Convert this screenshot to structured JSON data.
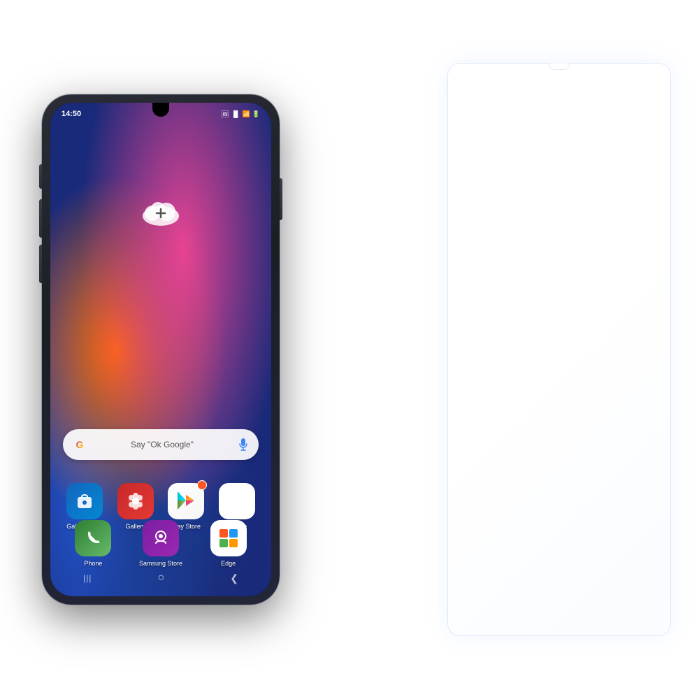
{
  "page": {
    "background_color": "#ffffff"
  },
  "status_bar": {
    "time": "14:50",
    "icons": [
      "photo",
      "signal",
      "wifi",
      "battery"
    ]
  },
  "search_bar": {
    "google_label": "G",
    "placeholder": "Say \"Ok Google\"",
    "mic_label": "🎤"
  },
  "apps": [
    {
      "id": "galaxy-store",
      "label": "Galaxy Store",
      "icon_type": "galaxy-store"
    },
    {
      "id": "gallery",
      "label": "Gallery",
      "icon_type": "gallery"
    },
    {
      "id": "play-store",
      "label": "Play Store",
      "icon_type": "play-store"
    },
    {
      "id": "google",
      "label": "Google",
      "icon_type": "google"
    }
  ],
  "dock": [
    {
      "id": "phone",
      "label": "Phone",
      "icon_type": "phone"
    },
    {
      "id": "samsung-store",
      "label": "Samsung Store",
      "icon_type": "samsung-store"
    },
    {
      "id": "edge",
      "label": "Edge",
      "icon_type": "edge"
    }
  ],
  "nav_bar": {
    "back": "❮",
    "home": "⬤",
    "recents": "|||"
  },
  "glass": {
    "visible": true
  }
}
